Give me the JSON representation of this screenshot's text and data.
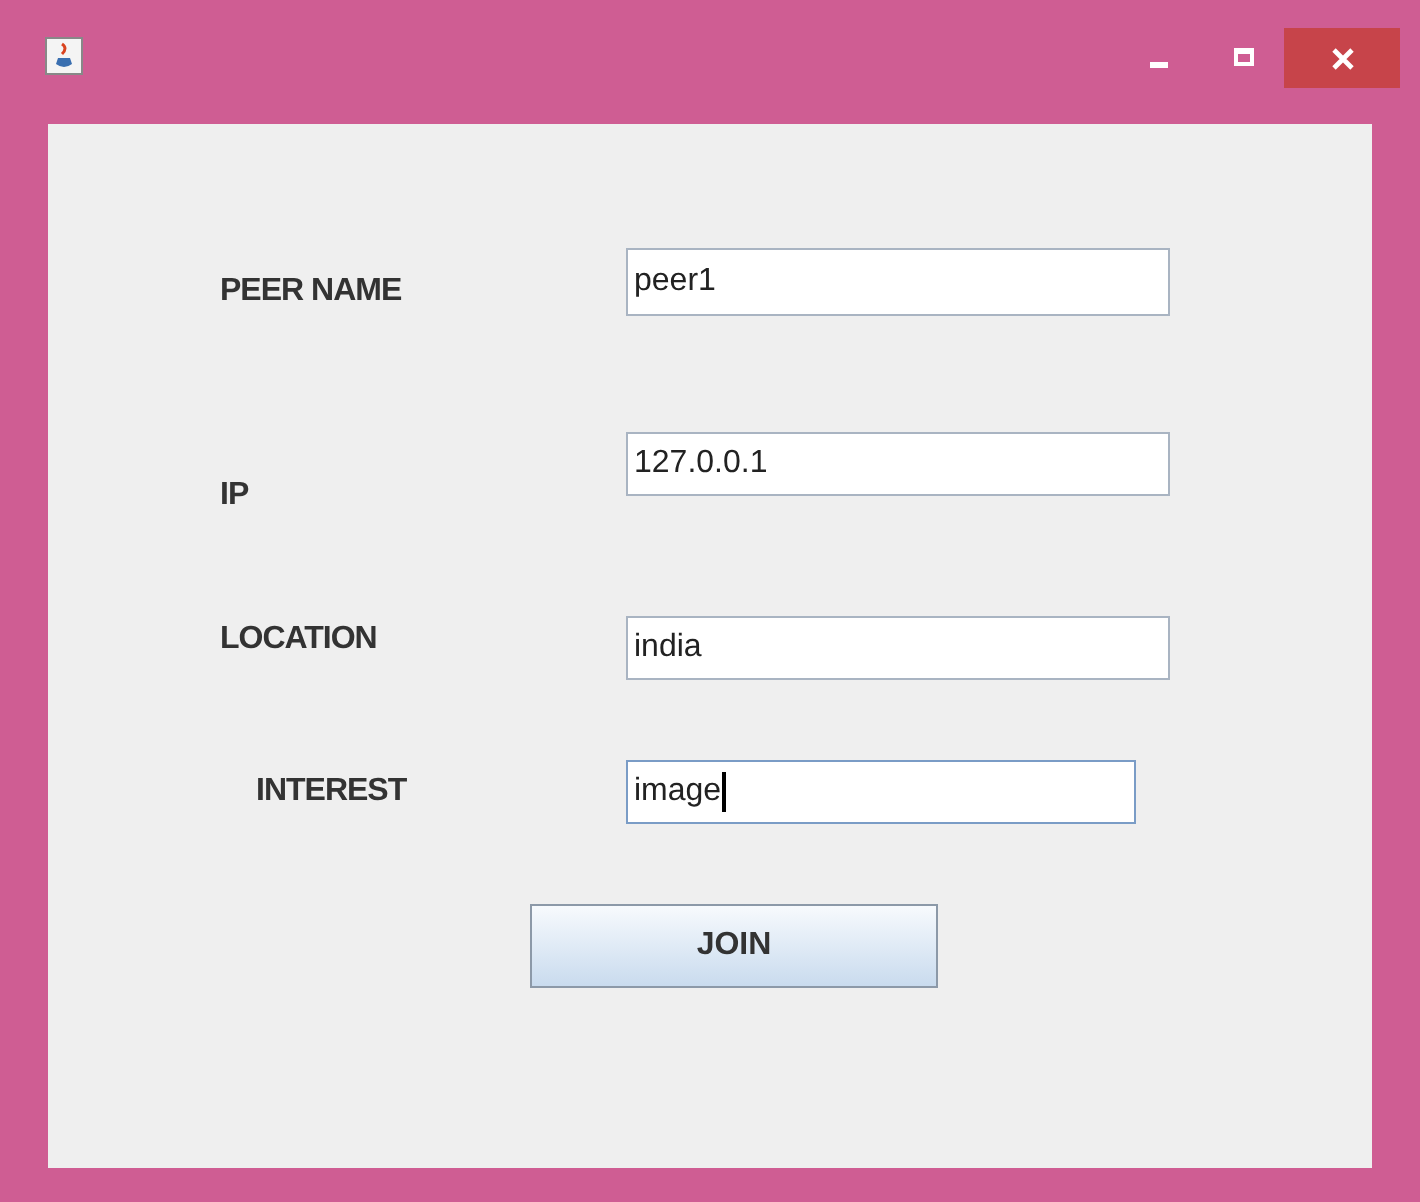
{
  "window": {
    "title_buttons": [
      {
        "kind": "minimize"
      },
      {
        "kind": "maximize"
      },
      {
        "kind": "close"
      }
    ]
  },
  "fields": [
    {
      "label": "PEER NAME",
      "value": "peer1",
      "focused": false
    },
    {
      "label": "IP",
      "value": "127.0.0.1",
      "focused": false
    },
    {
      "label": "LOCATION",
      "value": "india",
      "focused": false
    },
    {
      "label": "INTEREST",
      "value": "image",
      "focused": true
    }
  ],
  "button": "JOIN"
}
